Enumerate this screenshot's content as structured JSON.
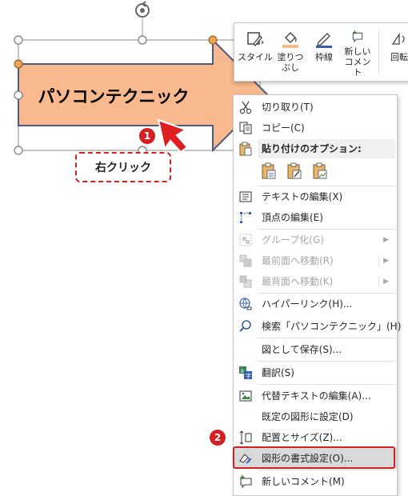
{
  "shape": {
    "text": "パソコンテクニック",
    "fill_color": "#f8b98f",
    "outline_color": "#4a5a80"
  },
  "callout": {
    "label": "右クリック"
  },
  "steps": {
    "step1": "1",
    "step2": "2"
  },
  "mini_toolbar": {
    "buttons": [
      {
        "label": "スタイル",
        "icon": "style-icon"
      },
      {
        "label": "塗りつ\nぶし",
        "icon": "fill-bucket-icon"
      },
      {
        "label": "枠線",
        "icon": "outline-pen-icon"
      },
      {
        "label": "新しい\nコメント",
        "icon": "new-comment-icon"
      },
      {
        "label": "回転",
        "icon": "rotate-icon"
      }
    ]
  },
  "context_menu": {
    "cut": "切り取り(T)",
    "copy": "コピー(C)",
    "paste_options": "貼り付けのオプション:",
    "edit_text": "テキストの編集(X)",
    "edit_points": "頂点の編集(E)",
    "group": "グループ化(G)",
    "bring_front": "最前面へ移動(R)",
    "send_back": "最背面へ移動(K)",
    "hyperlink": "ハイパーリンク(H)...",
    "search": "検索「パソコンテクニック」(H)",
    "save_as_picture": "図として保存(S)...",
    "translate": "翻訳(S)",
    "alt_text": "代替テキストの編集(A)...",
    "set_default_shape": "既定の図形に設定(D)",
    "size_position": "配置とサイズ(Z)...",
    "format_shape": "図形の書式設定(O)...",
    "new_comment": "新しいコメント(M)"
  },
  "colors": {
    "accent_red": "#d42020",
    "highlight": "#d9d9d9"
  }
}
